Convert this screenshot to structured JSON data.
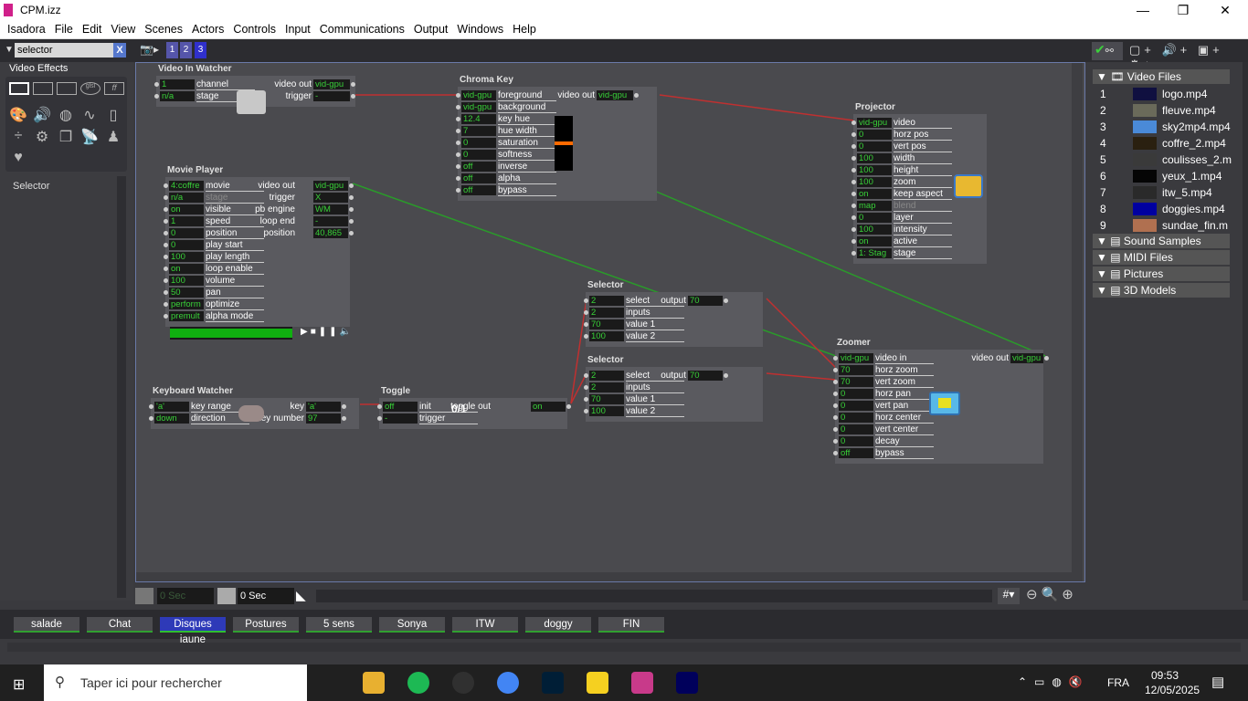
{
  "window": {
    "title": "CPM.izz",
    "minimize": "—",
    "maximize": "❐",
    "close": "✕"
  },
  "menu": [
    "Isadora",
    "File",
    "Edit",
    "View",
    "Scenes",
    "Actors",
    "Controls",
    "Input",
    "Communications",
    "Output",
    "Windows",
    "Help"
  ],
  "toolbar": {
    "search_value": "selector",
    "clear": "X",
    "scene_buttons": [
      "1",
      "2",
      "3"
    ]
  },
  "left_panel": {
    "category": "Video Effects",
    "selected_actor": "Selector",
    "icons": [
      "glsl",
      "ff"
    ]
  },
  "actors": {
    "video_in_watcher": {
      "title": "Video In Watcher",
      "inputs": [
        {
          "v": "1",
          "l": "channel"
        },
        {
          "v": "n/a",
          "l": "stage"
        }
      ],
      "outputs": [
        {
          "l": "video out",
          "v": "vid-gpu"
        },
        {
          "l": "trigger",
          "v": "-"
        }
      ]
    },
    "chroma_key": {
      "title": "Chroma Key",
      "inputs": [
        {
          "v": "vid-gpu",
          "l": "foreground"
        },
        {
          "v": "vid-gpu",
          "l": "background"
        },
        {
          "v": "12.4",
          "l": "key hue"
        },
        {
          "v": "7",
          "l": "hue width"
        },
        {
          "v": "0",
          "l": "saturation"
        },
        {
          "v": "0",
          "l": "softness"
        },
        {
          "v": "off",
          "l": "inverse"
        },
        {
          "v": "off",
          "l": "alpha"
        },
        {
          "v": "off",
          "l": "bypass"
        }
      ],
      "outputs": [
        {
          "l": "video out",
          "v": "vid-gpu"
        }
      ]
    },
    "projector": {
      "title": "Projector",
      "inputs": [
        {
          "v": "vid-gpu",
          "l": "video"
        },
        {
          "v": "0",
          "l": "horz pos"
        },
        {
          "v": "0",
          "l": "vert pos"
        },
        {
          "v": "100",
          "l": "width"
        },
        {
          "v": "100",
          "l": "height"
        },
        {
          "v": "100",
          "l": "zoom"
        },
        {
          "v": "on",
          "l": "keep aspect"
        },
        {
          "v": "map",
          "l": "blend"
        },
        {
          "v": "0",
          "l": "layer"
        },
        {
          "v": "100",
          "l": "intensity"
        },
        {
          "v": "on",
          "l": "active"
        },
        {
          "v": "1: Stag",
          "l": "stage"
        }
      ]
    },
    "movie_player": {
      "title": "Movie Player",
      "inputs": [
        {
          "v": "4:coffre",
          "l": "movie"
        },
        {
          "v": "n/a",
          "l": "stage"
        },
        {
          "v": "on",
          "l": "visible"
        },
        {
          "v": "1",
          "l": "speed"
        },
        {
          "v": "0",
          "l": "position"
        },
        {
          "v": "0",
          "l": "play start"
        },
        {
          "v": "100",
          "l": "play length"
        },
        {
          "v": "on",
          "l": "loop enable"
        },
        {
          "v": "100",
          "l": "volume"
        },
        {
          "v": "50",
          "l": "pan"
        },
        {
          "v": "perform",
          "l": "optimize"
        },
        {
          "v": "premult",
          "l": "alpha mode"
        }
      ],
      "outputs": [
        {
          "l": "video out",
          "v": "vid-gpu"
        },
        {
          "l": "trigger",
          "v": "X"
        },
        {
          "l": "pb engine",
          "v": "WM"
        },
        {
          "l": "loop end",
          "v": "-"
        },
        {
          "l": "position",
          "v": "40,865"
        }
      ]
    },
    "selector1": {
      "title": "Selector",
      "inputs": [
        {
          "v": "2",
          "l": "select"
        },
        {
          "v": "2",
          "l": "inputs"
        },
        {
          "v": "70",
          "l": "value 1"
        },
        {
          "v": "100",
          "l": "value 2"
        }
      ],
      "outputs": [
        {
          "l": "output",
          "v": "70"
        }
      ]
    },
    "selector2": {
      "title": "Selector",
      "inputs": [
        {
          "v": "2",
          "l": "select"
        },
        {
          "v": "2",
          "l": "inputs"
        },
        {
          "v": "70",
          "l": "value 1"
        },
        {
          "v": "100",
          "l": "value 2"
        }
      ],
      "outputs": [
        {
          "l": "output",
          "v": "70"
        }
      ]
    },
    "keyboard_watcher": {
      "title": "Keyboard Watcher",
      "inputs": [
        {
          "v": "'a'",
          "l": "key range"
        },
        {
          "v": "down",
          "l": "direction"
        }
      ],
      "outputs": [
        {
          "l": "key",
          "v": "'a'"
        },
        {
          "l": "key number",
          "v": "97"
        }
      ]
    },
    "toggle": {
      "title": "Toggle",
      "badge": "0/1",
      "inputs": [
        {
          "v": "off",
          "l": "init"
        },
        {
          "v": "-",
          "l": "trigger"
        }
      ],
      "outputs": [
        {
          "l": "toggle out",
          "v": "on"
        }
      ]
    },
    "zoomer": {
      "title": "Zoomer",
      "inputs": [
        {
          "v": "vid-gpu",
          "l": "video in"
        },
        {
          "v": "70",
          "l": "horz zoom"
        },
        {
          "v": "70",
          "l": "vert zoom"
        },
        {
          "v": "0",
          "l": "horz pan"
        },
        {
          "v": "0",
          "l": "vert pan"
        },
        {
          "v": "0",
          "l": "horz center"
        },
        {
          "v": "0",
          "l": "vert center"
        },
        {
          "v": "0",
          "l": "decay"
        },
        {
          "v": "off",
          "l": "bypass"
        }
      ],
      "outputs": [
        {
          "l": "video out",
          "v": "vid-gpu"
        }
      ]
    }
  },
  "right_panel": {
    "video_header": "Video Files",
    "media": [
      {
        "n": "1",
        "name": "logo.mp4",
        "color": "#101040"
      },
      {
        "n": "2",
        "name": "fleuve.mp4",
        "color": "#6a6a5a"
      },
      {
        "n": "3",
        "name": "sky2mp4.mp4",
        "color": "#4a8ad8"
      },
      {
        "n": "4",
        "name": "coffre_2.mp4",
        "color": "#2a2010"
      },
      {
        "n": "5",
        "name": "coulisses_2.m",
        "color": "#3a3a3a"
      },
      {
        "n": "6",
        "name": "yeux_1.mp4",
        "color": "#050505"
      },
      {
        "n": "7",
        "name": "itw_5.mp4",
        "color": "#2a2a2a"
      },
      {
        "n": "8",
        "name": "doggies.mp4",
        "color": "#0000a0"
      },
      {
        "n": "9",
        "name": "sundae_fin.m",
        "color": "#b07050"
      }
    ],
    "sections": [
      "Sound Samples",
      "MIDI Files",
      "Pictures",
      "3D Models"
    ]
  },
  "timeline": {
    "time1": "0 Sec",
    "time2": "0 Sec",
    "hash": "#"
  },
  "scenes": [
    {
      "label": "salade",
      "active": false
    },
    {
      "label": "Chat",
      "active": false
    },
    {
      "label": "Disques jaune",
      "active": true
    },
    {
      "label": "Postures",
      "active": false
    },
    {
      "label": "5 sens",
      "active": false
    },
    {
      "label": "Sonya",
      "active": false
    },
    {
      "label": "ITW",
      "active": false
    },
    {
      "label": "doggy",
      "active": false
    },
    {
      "label": "FIN",
      "active": false
    }
  ],
  "taskbar": {
    "search_placeholder": "Taper ici pour rechercher",
    "lang": "FRA",
    "time": "09:53",
    "date": "12/05/2025",
    "apps": [
      "task-view",
      "file-explorer",
      "spotify",
      "obs",
      "chrome",
      "photoshop",
      "sticky-notes",
      "isadora",
      "premiere"
    ]
  },
  "colors": {
    "accent": "#5555aa",
    "value_text": "#38d038",
    "link_red": "#c03030",
    "link_green": "#2a9a2a"
  }
}
